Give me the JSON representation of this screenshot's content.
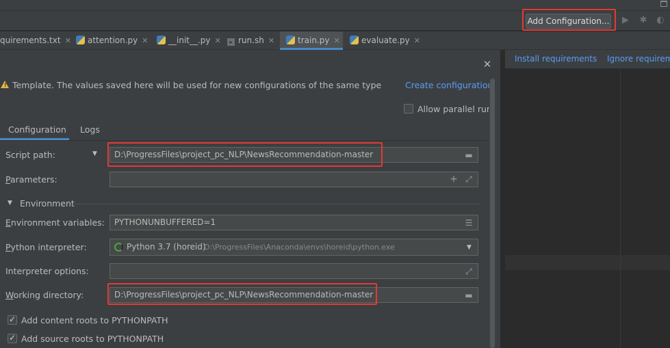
{
  "toolbar": {
    "add_configuration_label": "Add Configuration...",
    "run_icon": "play-icon",
    "debug_icon": "bug-icon",
    "coverage_icon": "coverage-icon"
  },
  "tabs": [
    {
      "label": "quirements.txt",
      "icon": "text-file-icon"
    },
    {
      "label": "attention.py",
      "icon": "python-file-icon"
    },
    {
      "label": "__init__.py",
      "icon": "python-file-icon"
    },
    {
      "label": "run.sh",
      "icon": "shell-file-icon"
    },
    {
      "label": "train.py",
      "icon": "python-file-icon",
      "active": true
    },
    {
      "label": "evaluate.py",
      "icon": "python-file-icon"
    }
  ],
  "notice": {
    "install_requirements": "Install requirements",
    "ignore_requirements": "Ignore requirem"
  },
  "dialog": {
    "template_text": "Template. The values saved here will be used for new configurations of the same type",
    "create_configuration": "Create configuration",
    "allow_parallel_run": "Allow parallel run",
    "subtabs": [
      "Configuration",
      "Logs"
    ],
    "script_path": {
      "label": "Script path:",
      "value": "D:\\ProgressFiles\\project_pc_NLP\\NewsRecommendation-master"
    },
    "parameters": {
      "label_prefix": "P",
      "label_rest": "arameters:",
      "value": ""
    },
    "environment_header": "Environment",
    "env_vars": {
      "label_prefix": "E",
      "label_rest": "nvironment variables:",
      "value": "PYTHONUNBUFFERED=1"
    },
    "interpreter": {
      "label_prefix": "P",
      "label_rest": "ython interpreter:",
      "name": "Python 3.7 (horeid)",
      "path": "D:\\ProgressFiles\\Anaconda\\envs\\horeid\\python.exe"
    },
    "interpreter_options": {
      "label": "Interpreter options:",
      "value": ""
    },
    "working_dir": {
      "label_prefix": "W",
      "label_rest": "orking directory:",
      "value": "D:\\ProgressFiles\\project_pc_NLP\\NewsRecommendation-master"
    },
    "add_content_roots": "Add content roots to PYTHONPATH",
    "add_source_roots": "Add source roots to PYTHONPATH",
    "add_content_roots_checked": true,
    "add_source_roots_checked": true,
    "allow_parallel_checked": false
  },
  "colors": {
    "highlight": "#e53935",
    "link": "#589df6",
    "accent": "#4a88c7",
    "warning": "#e3b341"
  }
}
